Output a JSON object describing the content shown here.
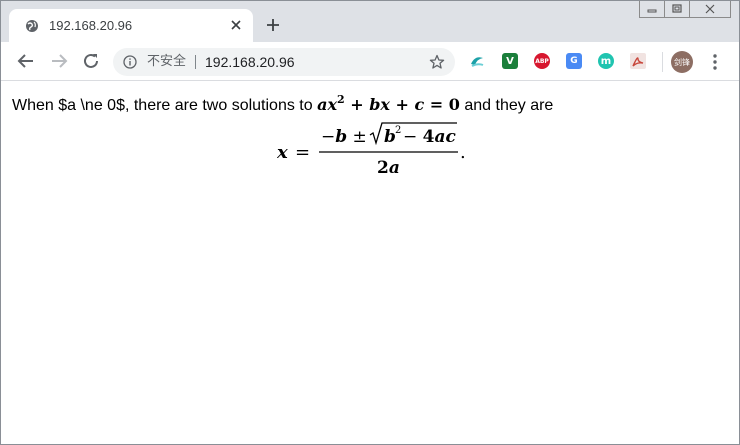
{
  "browser": {
    "tab_title": "192.168.20.96",
    "insecure_label": "不安全",
    "url": "192.168.20.96",
    "avatar_text": "剑锋"
  },
  "extensions": [
    {
      "name": "ext-swirl-icon",
      "color": "#1da1a8"
    },
    {
      "name": "ext-v-icon",
      "label": "V",
      "color": "#1b7f3b"
    },
    {
      "name": "adblock-plus-icon",
      "label": "ABP",
      "color": "#d7172f"
    },
    {
      "name": "google-translate-icon",
      "label": "G",
      "color": "#4a8af4"
    },
    {
      "name": "ext-m-icon",
      "label": "m",
      "color": "#20c4b0"
    },
    {
      "name": "pdf-icon",
      "color": "#c8473c"
    }
  ],
  "content": {
    "intro_text": "When $a \\ne 0$, there are two solutions to",
    "inline_formula": "ax² + bx + c = 0",
    "outro_text": "and they are",
    "display_formula": "x = (−b ± √(b² − 4ac)) / 2a."
  }
}
